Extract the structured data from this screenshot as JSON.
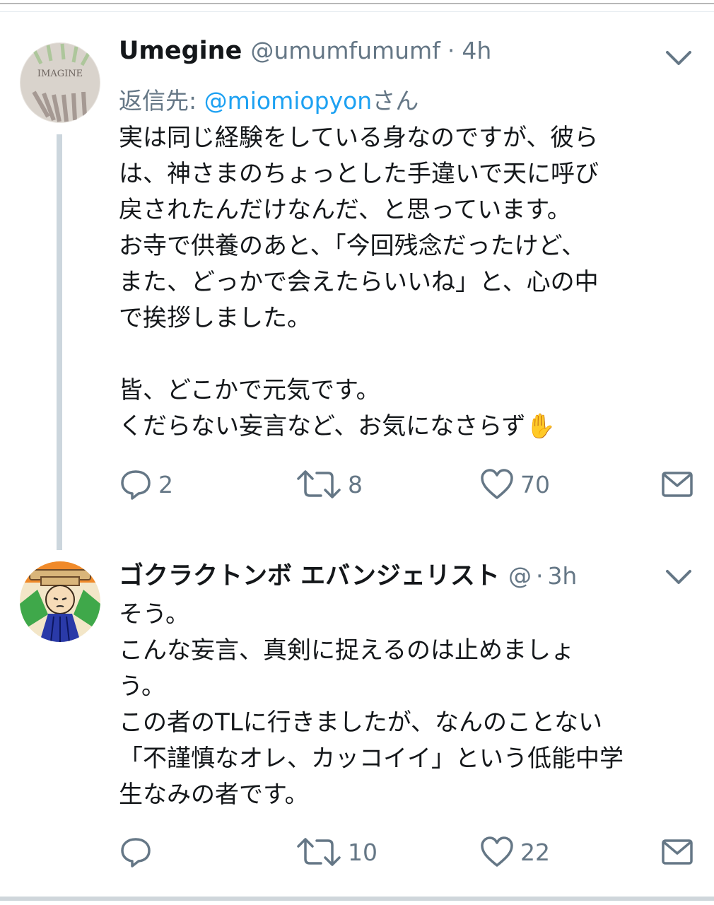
{
  "tweets": [
    {
      "name": "Umegine",
      "handle": "@umumfumumf",
      "separator": "·",
      "time": "4h",
      "reply_prefix": "返信先: ",
      "reply_mention": "@miomiopyon",
      "reply_suffix": "さん",
      "avatar_text": "IMAGINE",
      "body": "実は同じ経験をしている身なのですが、彼ら\nは、神さまのちょっとした手違いで天に呼び\n戻されたんだけなんだ、と思っています。\nお寺で供養のあと、「今回残念だったけど、\nまた、どっかで会えたらいいね」と、心の中\nで挨拶しました。\n\n皆、どこかで元気です。\nくだらない妄言など、お気になさらず✋",
      "reply_count": "2",
      "retweet_count": "8",
      "like_count": "70"
    },
    {
      "name": "ゴクラクトンボ エバンジェリスト",
      "handle": "@",
      "separator": "·",
      "time": "3h",
      "body": "そう。\nこんな妄言、真剣に捉えるのは止めましょ\nう。\nこの者のTLに行きましたが、なんのことない\n「不謹慎なオレ、カッコイイ」という低能中学\n生なみの者です。",
      "reply_count": "",
      "retweet_count": "10",
      "like_count": "22"
    }
  ],
  "icons": [
    "chevron-down-icon",
    "reply-icon",
    "retweet-icon",
    "like-icon",
    "dm-icon"
  ],
  "colors": {
    "secondary": "#657786",
    "link": "#1da1f2",
    "thread_line": "#ccd6dd"
  }
}
